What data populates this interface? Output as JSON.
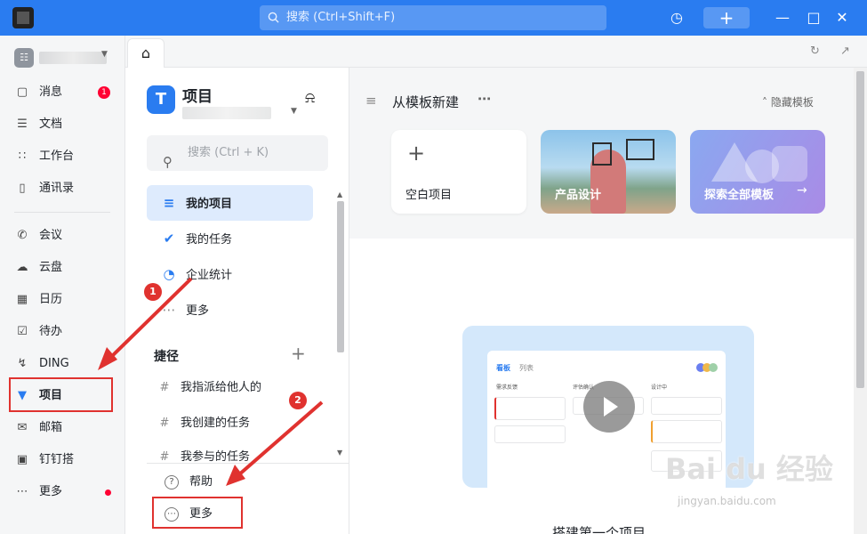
{
  "titlebar": {
    "search_placeholder": "搜索 (Ctrl+Shift+F)",
    "add_label": "+",
    "accent": "#2a7cf0"
  },
  "leftnav": {
    "items": [
      {
        "label": "消息",
        "icon": "chat-icon",
        "badge": "1"
      },
      {
        "label": "文档",
        "icon": "document-icon"
      },
      {
        "label": "工作台",
        "icon": "grid-icon"
      },
      {
        "label": "通讯录",
        "icon": "contacts-icon"
      },
      {
        "label": "会议",
        "icon": "phone-icon"
      },
      {
        "label": "云盘",
        "icon": "cloud-icon"
      },
      {
        "label": "日历",
        "icon": "calendar-icon"
      },
      {
        "label": "待办",
        "icon": "todo-icon"
      },
      {
        "label": "DING",
        "icon": "lightning-icon"
      },
      {
        "label": "项目",
        "icon": "project-icon",
        "active": true
      },
      {
        "label": "邮箱",
        "icon": "mail-icon"
      },
      {
        "label": "钉钉搭",
        "icon": "builder-icon"
      },
      {
        "label": "更多",
        "icon": "more-icon",
        "dot": true
      }
    ]
  },
  "project_sidebar": {
    "title": "项目",
    "search_placeholder": "搜索 (Ctrl + K)",
    "menu": [
      {
        "label": "我的项目",
        "icon": "layers-icon",
        "active": true
      },
      {
        "label": "我的任务",
        "icon": "check-circle-icon"
      },
      {
        "label": "企业统计",
        "icon": "pie-chart-icon"
      },
      {
        "label": "更多",
        "icon": "ellipsis-icon"
      }
    ],
    "section_label": "捷径",
    "shortcuts": [
      "我指派给他人的",
      "我创建的任务",
      "我参与的任务"
    ],
    "bottom": [
      {
        "label": "帮助",
        "icon": "help-icon"
      },
      {
        "label": "更多",
        "icon": "more-circle-icon"
      }
    ]
  },
  "main": {
    "template_title": "从模板新建",
    "hide_templates": "隐藏模板",
    "cards": [
      {
        "label": "空白项目"
      },
      {
        "label": "产品设计"
      },
      {
        "label": "探索全部模板"
      }
    ],
    "preview": {
      "tab_active": "看板",
      "tab_other": "列表",
      "columns": [
        "需求反馈",
        "评估确认",
        "设计中"
      ]
    },
    "caption": "搭建第一个项目"
  },
  "annotations": {
    "step1": "1",
    "step2": "2",
    "color": "#e0322f"
  },
  "watermark": {
    "text": "Bai du 经验",
    "url": "jingyan.baidu.com"
  }
}
